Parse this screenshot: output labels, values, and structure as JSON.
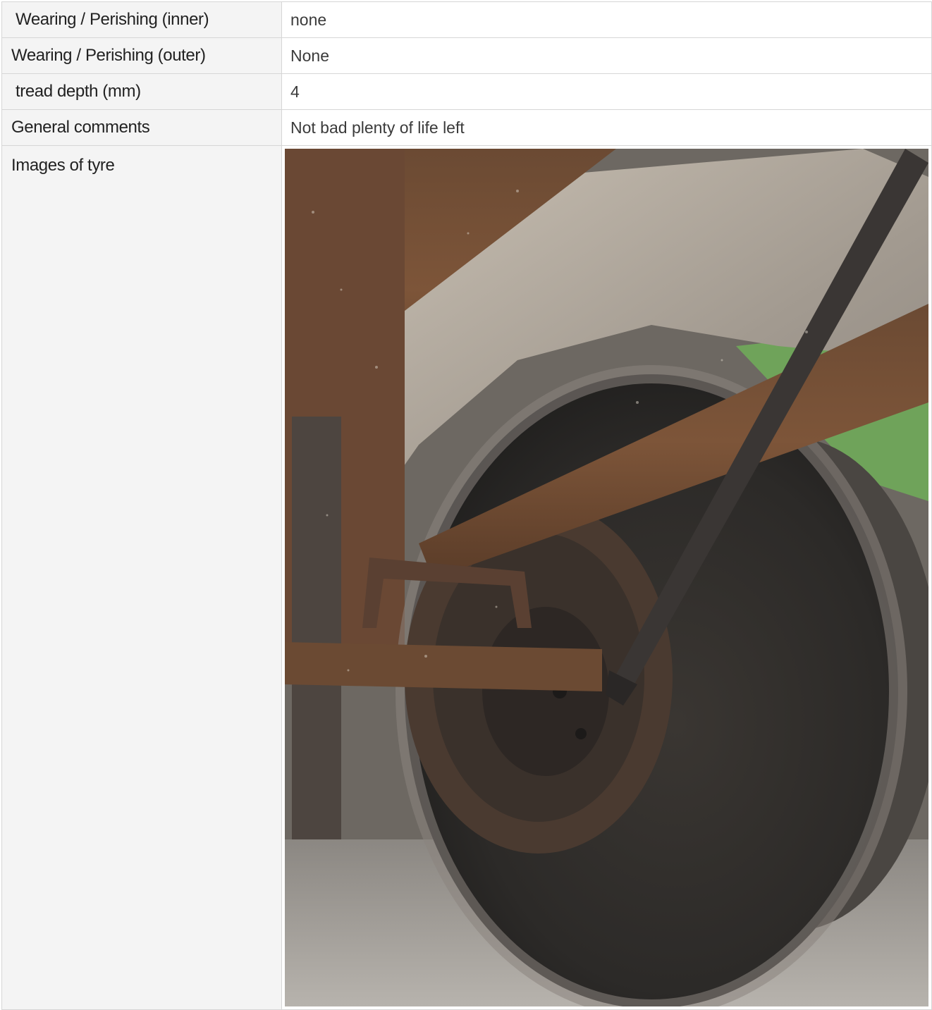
{
  "rows": [
    {
      "label": "Wearing / Perishing (inner)",
      "value": "none"
    },
    {
      "label": "Wearing / Perishing (outer)",
      "value": "None"
    },
    {
      "label": "tread depth (mm)",
      "value": "4"
    },
    {
      "label": "General comments",
      "value": "Not bad plenty of life left"
    }
  ],
  "images": {
    "label": "Images of tyre"
  }
}
